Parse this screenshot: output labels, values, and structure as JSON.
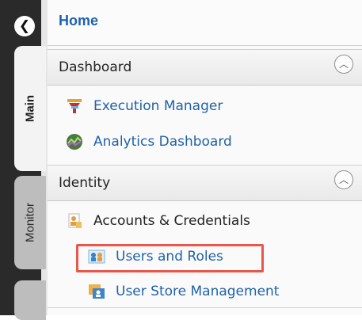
{
  "nav": {
    "collapse_glyph": "❮",
    "tabs": [
      {
        "label": "Main",
        "selected": true
      },
      {
        "label": "Monitor",
        "selected": false
      }
    ]
  },
  "menu": {
    "home_label": "Home",
    "sections": [
      {
        "title": "Dashboard",
        "toggle_glyph": "︿",
        "items": [
          {
            "label": "Execution Manager",
            "icon": "execution-manager-icon"
          },
          {
            "label": "Analytics Dashboard",
            "icon": "analytics-dashboard-icon"
          }
        ]
      },
      {
        "title": "Identity",
        "toggle_glyph": "︿",
        "items": [
          {
            "label": "Accounts & Credentials",
            "icon": "accounts-credentials-icon",
            "is_group": true
          },
          {
            "label": "Users and Roles",
            "icon": "users-roles-icon",
            "highlighted": true
          },
          {
            "label": "User Store Management",
            "icon": "user-store-icon"
          }
        ]
      }
    ]
  },
  "colors": {
    "link": "#1f62a8",
    "highlight_border": "#e8574c",
    "tab_strip": "#2a2a2a"
  }
}
